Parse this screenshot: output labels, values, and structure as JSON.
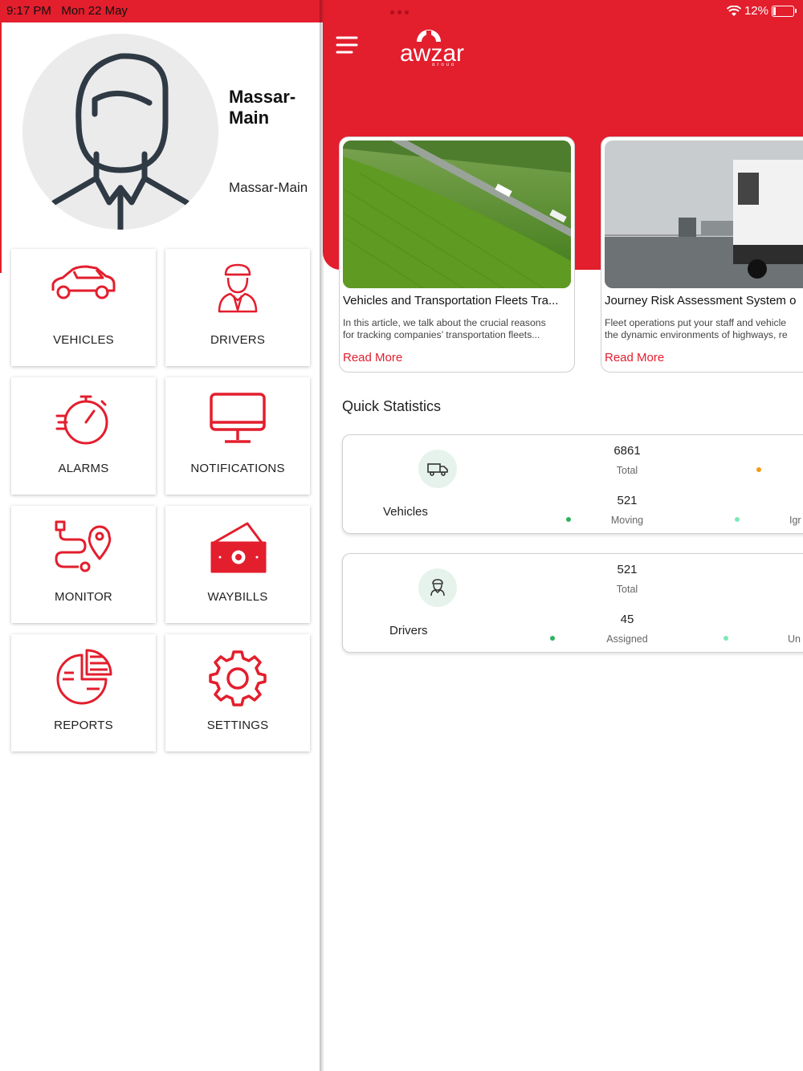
{
  "status_bar": {
    "time": "9:17 PM",
    "date": "Mon 22 May",
    "battery": "12%"
  },
  "profile": {
    "name": "Massar-Main",
    "subtitle": "Massar-Main",
    "avatar_icon": "user-outline-icon"
  },
  "menu_tiles": [
    {
      "label": "VEHICLES",
      "icon": "car-icon"
    },
    {
      "label": "DRIVERS",
      "icon": "driver-icon"
    },
    {
      "label": "ALARMS",
      "icon": "stopwatch-icon"
    },
    {
      "label": "NOTIFICATIONS",
      "icon": "monitor-icon"
    },
    {
      "label": "MONITOR",
      "icon": "route-pin-icon"
    },
    {
      "label": "WAYBILLS",
      "icon": "money-icon"
    },
    {
      "label": "REPORTS",
      "icon": "pie-chart-icon"
    },
    {
      "label": "SETTINGS",
      "icon": "gear-icon"
    }
  ],
  "header": {
    "logo_text": "awzar",
    "logo_sub": "group",
    "menu_icon": "hamburger-icon"
  },
  "articles": [
    {
      "title": "Vehicles and Transportation Fleets Tra...",
      "desc_line1": "In this article, we talk about the crucial reasons",
      "desc_line2": "for tracking companies’ transportation fleets...",
      "link": "Read More"
    },
    {
      "title": "Journey Risk Assessment System o",
      "desc_line1": "Fleet operations put your staff and vehicle",
      "desc_line2": "the dynamic environments of highways, re",
      "link": "Read More"
    }
  ],
  "quick_stats": {
    "title": "Quick Statistics",
    "vehicles": {
      "label": "Vehicles",
      "total": "6861",
      "total_label": "Total",
      "moving": "521",
      "moving_label": "Moving",
      "cut_label": "Igr"
    },
    "drivers": {
      "label": "Drivers",
      "total": "521",
      "total_label": "Total",
      "assigned": "45",
      "assigned_label": "Assigned",
      "cut_label": "Un"
    }
  },
  "colors": {
    "brand_red": "#e31e2d",
    "dot_green": "#2db35d",
    "dot_orange": "#f39c12",
    "dot_mint": "#7de8b8"
  }
}
